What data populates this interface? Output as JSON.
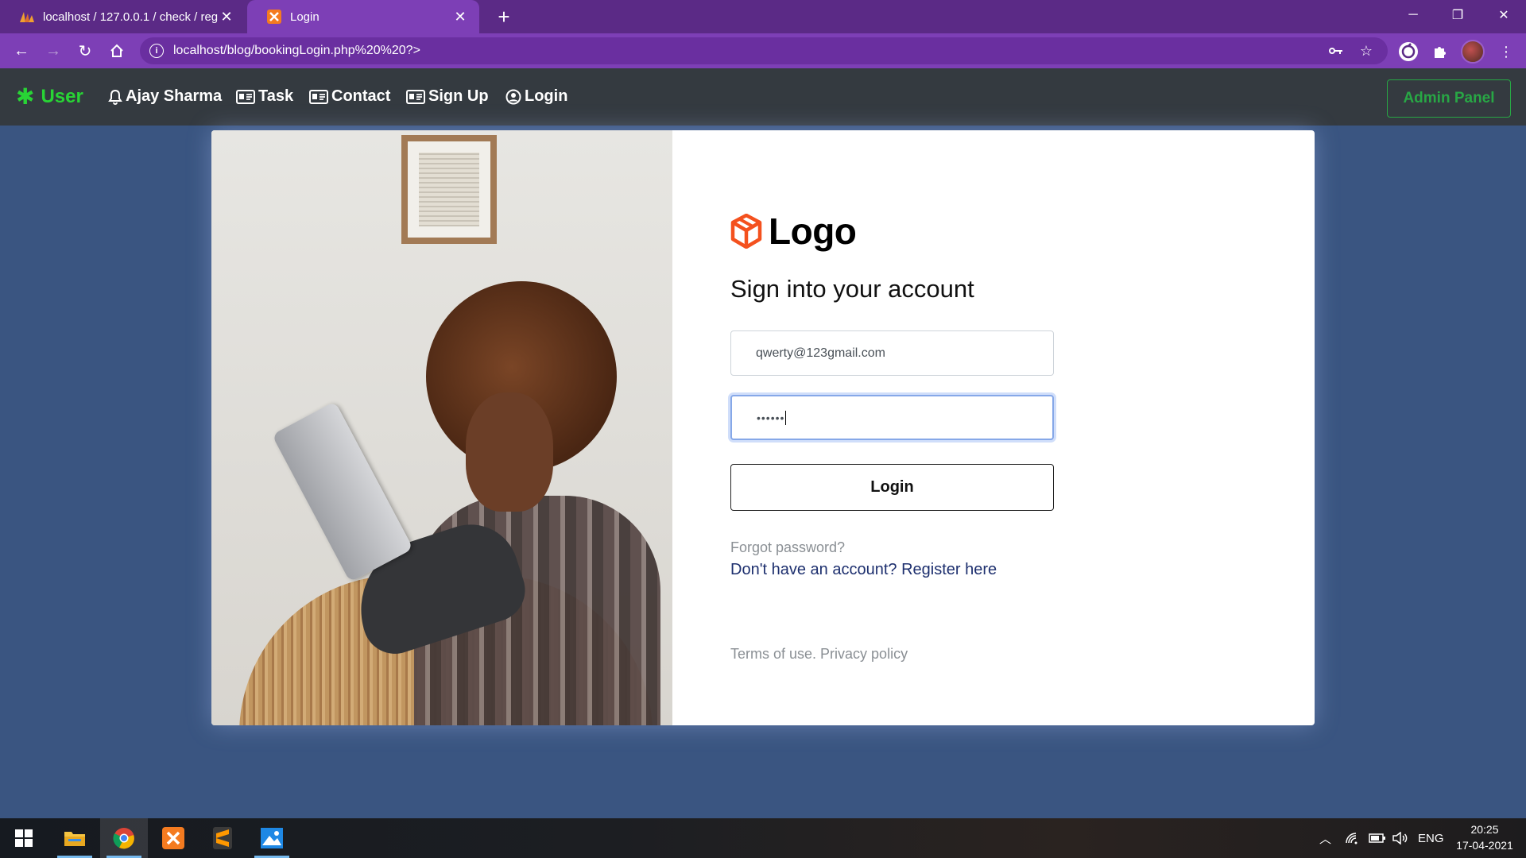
{
  "browser": {
    "tabs": [
      {
        "title": "localhost / 127.0.0.1 / check / reg",
        "favicon": "phpmyadmin-icon"
      },
      {
        "title": "Login",
        "favicon": "xampp-icon"
      }
    ],
    "url": "localhost/blog/bookingLogin.php%20%20?>"
  },
  "navbar": {
    "brand": "User",
    "links": [
      {
        "label": "Ajay Sharma",
        "icon": "bell-icon"
      },
      {
        "label": "Task",
        "icon": "id-card-icon"
      },
      {
        "label": "Contact",
        "icon": "id-card-icon"
      },
      {
        "label": "Sign Up",
        "icon": "id-card-icon"
      },
      {
        "label": "Login",
        "icon": "user-circle-icon"
      }
    ],
    "admin_button": "Admin Panel"
  },
  "login": {
    "logo_text": "Logo",
    "heading": "Sign into your account",
    "email_value": "qwerty@123gmail.com",
    "password_value": "••••••",
    "button": "Login",
    "forgot": "Forgot password?",
    "register": "Don't have an account? Register here",
    "terms": "Terms of use. Privacy policy"
  },
  "taskbar": {
    "language": "ENG",
    "time": "20:25",
    "date": "17-04-2021"
  },
  "colors": {
    "browser_tabbar": "#5b2a86",
    "browser_toolbar": "#7d3fb6",
    "navbar_bg": "#343a40",
    "brand_green": "#28d435",
    "admin_green": "#28a745",
    "page_bg": "#3a5581",
    "logo_orange": "#f4511e"
  }
}
